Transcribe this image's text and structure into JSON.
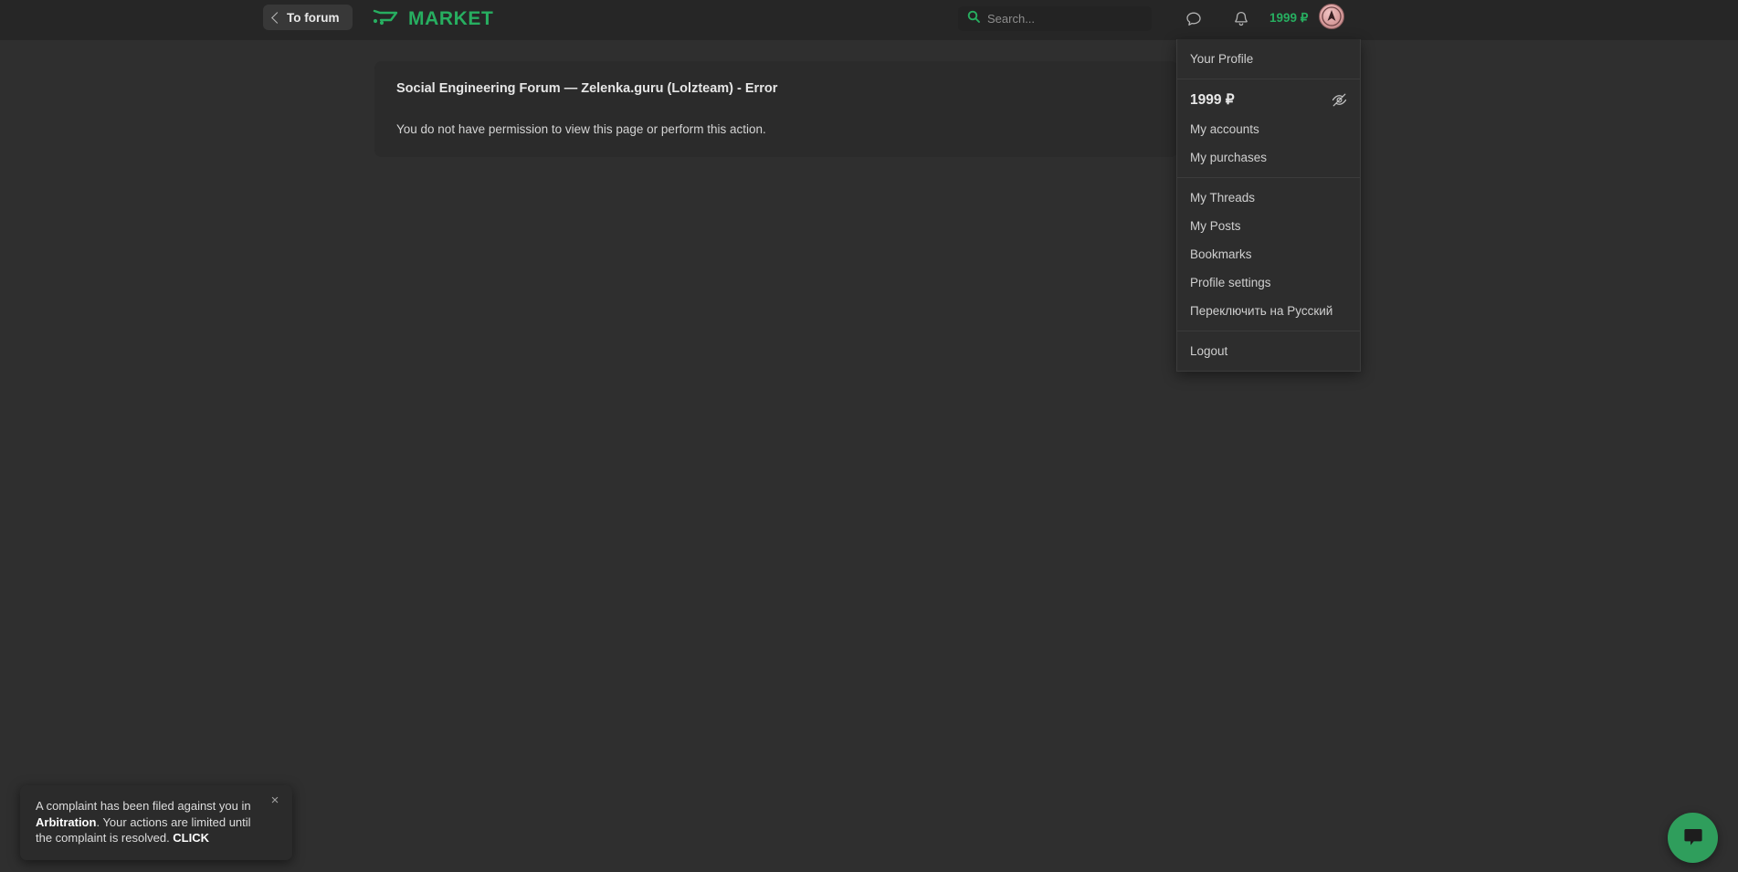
{
  "header": {
    "to_forum_label": "To forum",
    "brand_label": "MARKET",
    "brand_icon": "shopping-cart-icon",
    "search_placeholder": "Search...",
    "search_value": "",
    "search_icon": "search-icon",
    "messages_icon": "speech-bubble-icon",
    "notifications_icon": "bell-icon",
    "balance": "1999 ₽",
    "avatar_alt": "user-avatar"
  },
  "main": {
    "card_title": "Social Engineering Forum — Zelenka.guru (Lolzteam) - Error",
    "card_body": "You do not have permission to view this page or perform this action."
  },
  "dropdown": {
    "profile_label": "Your Profile",
    "balance_value": "1999 ₽",
    "hide_balance_icon": "eye-off-icon",
    "account_items": [
      {
        "label": "My accounts"
      },
      {
        "label": "My purchases"
      }
    ],
    "nav_items": [
      {
        "label": "My Threads"
      },
      {
        "label": "My Posts"
      },
      {
        "label": "Bookmarks"
      },
      {
        "label": "Profile settings"
      },
      {
        "label": "Переключить на Русский"
      }
    ],
    "logout_label": "Logout"
  },
  "toast": {
    "text_part1": "A complaint has been filed against you in ",
    "bold_word": "Arbitration",
    "text_part2": ". Your actions are limited until the complaint is resolved. ",
    "link_label": "CLICK",
    "close_icon": "close-icon",
    "close_label": "×"
  },
  "chat_widget": {
    "icon": "chat-bubble-icon",
    "color": "#2f9e5c"
  },
  "colors": {
    "accent_green": "#27ae60",
    "header_bg": "#262626",
    "body_bg": "#2f2f2f",
    "card_bg": "#2b2b2b",
    "dropdown_bg": "#2d2d2d"
  }
}
